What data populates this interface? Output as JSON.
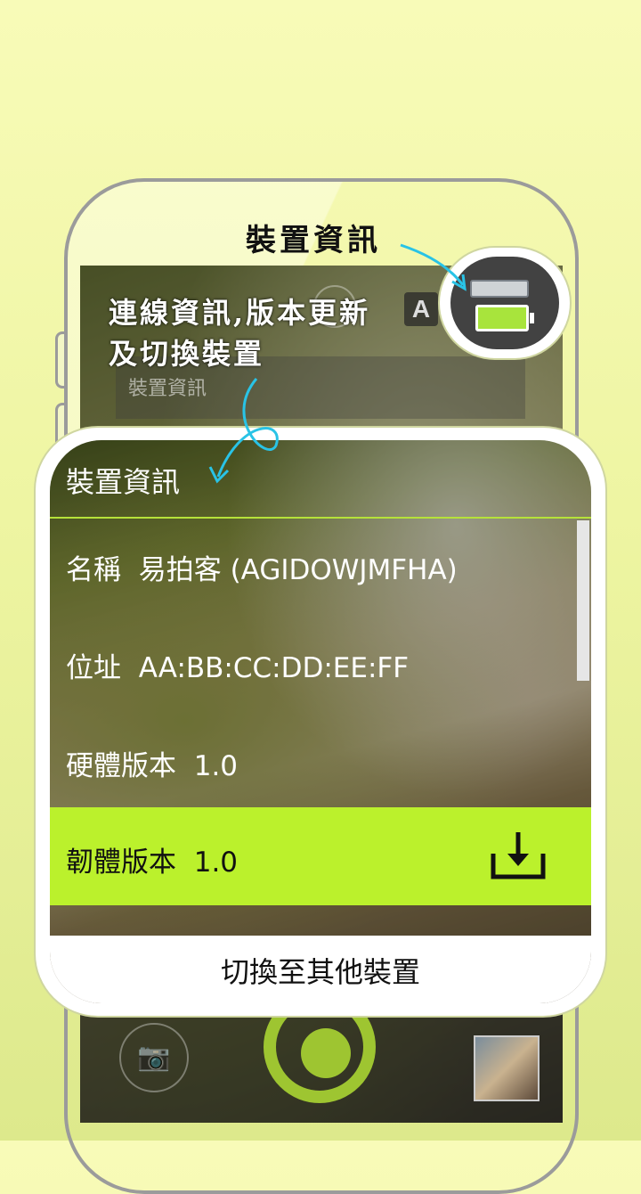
{
  "annotations": {
    "device_info_title": "裝置資訊",
    "line1": "連線資訊,版本更新",
    "line2": "及切換裝置"
  },
  "background_screen": {
    "menu_label": "裝置資訊",
    "top_badge": "A"
  },
  "dialog": {
    "header": "裝置資訊",
    "rows": [
      {
        "label": "名稱",
        "value": "易拍客 (AGIDOWJMFHA)"
      },
      {
        "label": "位址",
        "value": "AA:BB:CC:DD:EE:FF"
      },
      {
        "label": "硬體版本",
        "value": "1.0"
      },
      {
        "label": "韌體版本",
        "value": "1.0"
      }
    ],
    "switch_button": "切換至其他裝置"
  },
  "colors": {
    "accent_green": "#bbf12c",
    "shutter_green": "#9ec531",
    "arrow_cyan": "#29c3e6"
  },
  "icons": [
    "usb-icon",
    "battery-icon",
    "download-icon",
    "camera-icon",
    "shutter-icon",
    "gallery-thumbnail"
  ]
}
